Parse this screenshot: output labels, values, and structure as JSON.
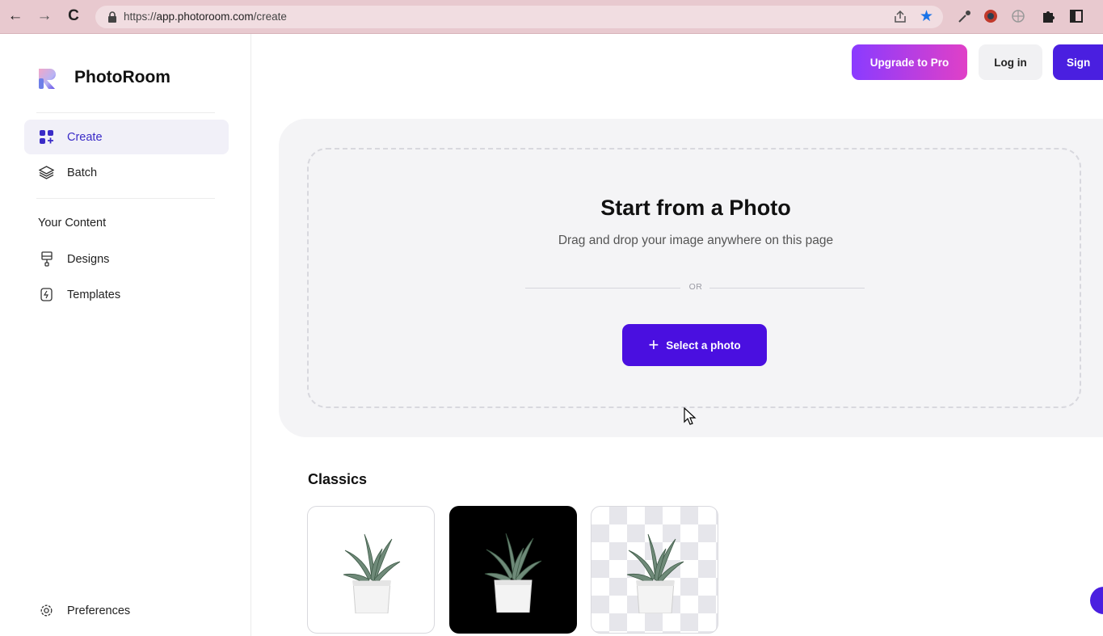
{
  "browser": {
    "url_prefix": "https://",
    "url_host": "app.photoroom.com",
    "url_path": "/create"
  },
  "sidebar": {
    "brand": "PhotoRoom",
    "items": [
      {
        "label": "Create",
        "icon": "create-grid-icon",
        "active": true
      },
      {
        "label": "Batch",
        "icon": "layers-icon",
        "active": false
      }
    ],
    "section_label": "Your Content",
    "content_items": [
      {
        "label": "Designs",
        "icon": "brush-icon"
      },
      {
        "label": "Templates",
        "icon": "template-icon"
      }
    ],
    "preferences_label": "Preferences"
  },
  "header": {
    "upgrade_label": "Upgrade to Pro",
    "login_label": "Log in",
    "signup_label": "Sign"
  },
  "main": {
    "title": "Start from a Photo",
    "subtitle": "Drag and drop your image anywhere on this page",
    "or_label": "OR",
    "select_label": "Select a photo",
    "classics_title": "Classics",
    "classics": [
      {
        "style": "white-background"
      },
      {
        "style": "black-background"
      },
      {
        "style": "transparent-background"
      }
    ]
  },
  "colors": {
    "accent": "#4a0fe0",
    "active_nav_bg": "#f1f0f8",
    "panel_bg": "#f4f4f6",
    "chrome_bg": "#e8c9cf"
  }
}
